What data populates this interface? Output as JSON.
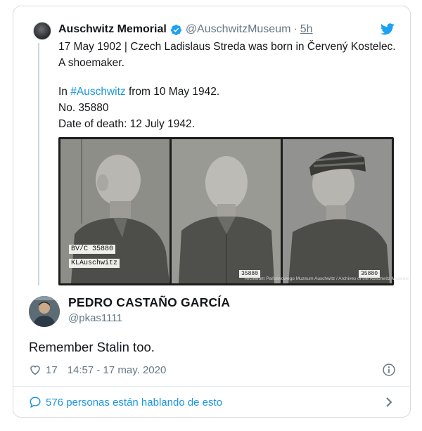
{
  "quoted": {
    "name": "Auschwitz Memorial",
    "handle": "@AuschwitzMuseum",
    "separator": "·",
    "time": "5h",
    "line1": "17 May 1902 | Czech Ladislaus Streda was born in Červený Kostelec. A shoemaker.",
    "line2_prefix": "In ",
    "line2_hashtag": "#Auschwitz",
    "line2_suffix": " from 10 May 1942.",
    "line3": "No. 35880",
    "line4": "Date of death: 12 July 1942.",
    "photo": {
      "label_top": "BV/C 35880",
      "label_bottom": "KLAuschwitz",
      "number_tag_center": "35880",
      "number_tag_right": "35880",
      "watermark": "Archiwum Państwowego Muzeum Auschwitz / Archives of the Auschwitz Museum"
    }
  },
  "tweet": {
    "name": "PEDRO CASTAÑO GARCÍA",
    "handle": "@pkas1111",
    "text": "Remember Stalin too.",
    "likes": "17",
    "timestamp": "14:57 - 17 may. 2020"
  },
  "footer": {
    "conversation": "576 personas están hablando de esto"
  },
  "icons": {
    "verified": "verified-badge-icon",
    "twitter": "twitter-bird-icon",
    "like": "heart-icon",
    "info": "info-icon",
    "conversation": "speech-bubble-icon",
    "chevron": "chevron-right-icon"
  },
  "colors": {
    "twitter_blue": "#1b95e0",
    "secondary_text": "#657786",
    "primary_text": "#14171a"
  }
}
